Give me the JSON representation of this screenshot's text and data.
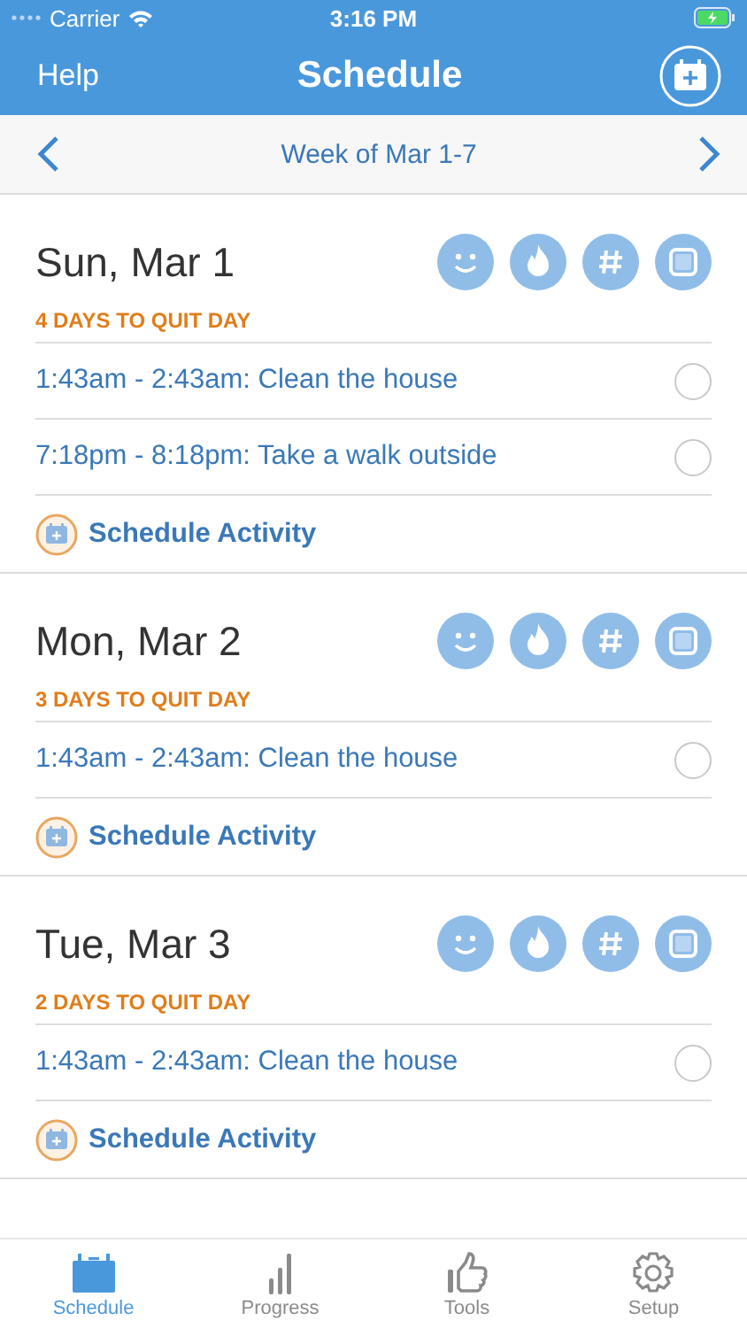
{
  "status_bar": {
    "carrier": "Carrier",
    "time": "3:16 PM"
  },
  "nav": {
    "left": "Help",
    "title": "Schedule"
  },
  "week": {
    "label": "Week of Mar 1-7"
  },
  "days": [
    {
      "date": "Sun, Mar 1",
      "countdown": "4 DAYS TO QUIT DAY",
      "activities": [
        {
          "text": "1:43am - 2:43am: Clean the house",
          "checked": false
        },
        {
          "text": "7:18pm - 8:18pm: Take a walk outside",
          "checked": false
        }
      ],
      "action": "Schedule Activity"
    },
    {
      "date": "Mon, Mar 2",
      "countdown": "3 DAYS TO QUIT DAY",
      "activities": [
        {
          "text": "1:43am - 2:43am: Clean the house",
          "checked": false
        }
      ],
      "action": "Schedule Activity"
    },
    {
      "date": "Tue, Mar 3",
      "countdown": "2 DAYS TO QUIT DAY",
      "activities": [
        {
          "text": "1:43am - 2:43am: Clean the house",
          "checked": false
        }
      ],
      "action": "Schedule Activity"
    }
  ],
  "tabs": [
    {
      "label": "Schedule",
      "kind": "calendar",
      "selected": true
    },
    {
      "label": "Progress",
      "kind": "bars",
      "selected": false
    },
    {
      "label": "Tools",
      "kind": "thumb",
      "selected": false
    },
    {
      "label": "Setup",
      "kind": "gear",
      "selected": false
    }
  ]
}
